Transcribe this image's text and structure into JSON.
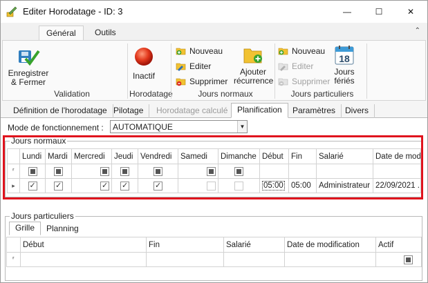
{
  "window": {
    "title": "Editer Horodatage - ID: 3",
    "controls": {
      "minimize": "—",
      "maximize": "☐",
      "close": "✕"
    }
  },
  "ribbon_tabs": [
    "Général",
    "Outils"
  ],
  "ribbon": {
    "validation": {
      "save_label_1": "Enregistrer",
      "save_label_2": "& Fermer",
      "group": "Validation"
    },
    "horodatage": {
      "inactive_label": "Inactif",
      "group": "Horodatage"
    },
    "jours_normaux": {
      "new": "Nouveau",
      "edit": "Editer",
      "delete": "Supprimer",
      "add_recurrence_1": "Ajouter",
      "add_recurrence_2": "récurrence",
      "group": "Jours normaux"
    },
    "jours_particuliers": {
      "new": "Nouveau",
      "edit": "Editer",
      "delete": "Supprimer",
      "holidays_1": "Jours",
      "holidays_2": "fériés",
      "calendar_day": "18",
      "group": "Jours particuliers"
    }
  },
  "page_tabs": [
    "Définition de l'horodatage",
    "Pilotage",
    "Horodatage calculé",
    "Planification",
    "Paramètres",
    "Divers"
  ],
  "mode": {
    "label": "Mode de fonctionnement :",
    "value": "AUTOMATIQUE"
  },
  "jours_normaux": {
    "title": "Jours normaux",
    "columns": [
      "Lundi",
      "Mardi",
      "Mercredi",
      "Jeudi",
      "Vendredi",
      "Samedi",
      "Dimanche",
      "Début",
      "Fin",
      "Salarié",
      "Date de modi"
    ],
    "filter_indicator": "⸢",
    "row_indicator": "▸",
    "row": {
      "debut": "05:00",
      "fin": "05:00",
      "salarie": "Administrateur",
      "date": "22/09/2021 ."
    }
  },
  "jours_particuliers": {
    "title": "Jours particuliers",
    "tabs": [
      "Grille",
      "Planning"
    ],
    "columns": [
      "Début",
      "Fin",
      "Salarié",
      "Date de modification",
      "Actif"
    ],
    "filter_indicator": "⸢"
  },
  "colors": {
    "highlight": "#e0131d",
    "ribbon_bg": "#fafafa"
  }
}
